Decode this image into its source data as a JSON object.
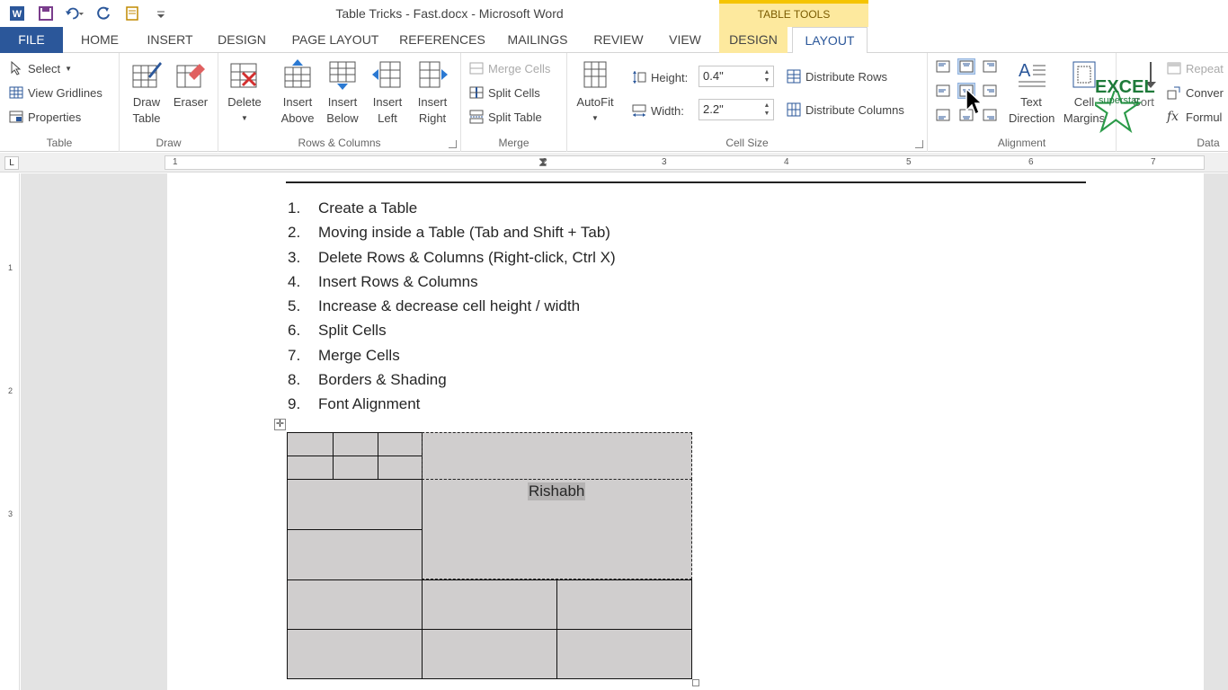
{
  "window": {
    "title": "Table Tricks - Fast.docx - Microsoft Word",
    "contextual_header": "TABLE TOOLS"
  },
  "tabs": [
    {
      "label": "FILE"
    },
    {
      "label": "HOME"
    },
    {
      "label": "INSERT"
    },
    {
      "label": "DESIGN"
    },
    {
      "label": "PAGE LAYOUT"
    },
    {
      "label": "REFERENCES"
    },
    {
      "label": "MAILINGS"
    },
    {
      "label": "REVIEW"
    },
    {
      "label": "VIEW"
    },
    {
      "label": "DESIGN"
    },
    {
      "label": "LAYOUT"
    }
  ],
  "ribbon": {
    "table": {
      "label": "Table",
      "select": "Select",
      "view_gridlines": "View Gridlines",
      "properties": "Properties"
    },
    "draw": {
      "label": "Draw",
      "draw_table_1": "Draw",
      "draw_table_2": "Table",
      "eraser": "Eraser"
    },
    "rows_columns": {
      "label": "Rows & Columns",
      "delete": "Delete",
      "insert_above_1": "Insert",
      "insert_above_2": "Above",
      "insert_below_1": "Insert",
      "insert_below_2": "Below",
      "insert_left_1": "Insert",
      "insert_left_2": "Left",
      "insert_right_1": "Insert",
      "insert_right_2": "Right"
    },
    "merge": {
      "label": "Merge",
      "merge_cells": "Merge Cells",
      "split_cells": "Split Cells",
      "split_table": "Split Table"
    },
    "cell_size": {
      "label": "Cell Size",
      "autofit": "AutoFit",
      "height_label": "Height:",
      "height_value": "0.4\"",
      "width_label": "Width:",
      "width_value": "2.2\"",
      "distribute_rows": "Distribute Rows",
      "distribute_columns": "Distribute Columns"
    },
    "alignment": {
      "label": "Alignment",
      "text_direction_1": "Text",
      "text_direction_2": "Direction",
      "cell_margins_1": "Cell",
      "cell_margins_2": "Margins"
    },
    "data": {
      "label": "Data",
      "sort": "Sort",
      "repeat": "Repeat",
      "convert": "Conver",
      "formula": "Formul"
    }
  },
  "ruler": {
    "numbers": [
      "1",
      "1",
      "2",
      "3",
      "4",
      "5",
      "6",
      "7"
    ],
    "corner": "L"
  },
  "vruler": {
    "numbers": [
      "1",
      "2",
      "3"
    ]
  },
  "document": {
    "list": [
      {
        "num": "1.",
        "text": "Create a Table"
      },
      {
        "num": "2.",
        "text": "Moving inside a Table (Tab and Shift + Tab)"
      },
      {
        "num": "3.",
        "text": "Delete Rows & Columns (Right-click, Ctrl X)"
      },
      {
        "num": "4.",
        "text": "Insert Rows & Columns"
      },
      {
        "num": "5.",
        "text": "Increase & decrease cell height / width"
      },
      {
        "num": "6.",
        "text": "Split Cells"
      },
      {
        "num": "7.",
        "text": "Merge Cells"
      },
      {
        "num": "8.",
        "text": "Borders & Shading"
      },
      {
        "num": "9.",
        "text": "Font Alignment"
      }
    ],
    "table_cell_text": "Rishabh"
  },
  "watermark": {
    "text": "EXCEL",
    "subtext": "superstar"
  },
  "colors": {
    "accent": "#2b579a",
    "contextual": "#fde99e",
    "table_shading": "#d0cece"
  }
}
